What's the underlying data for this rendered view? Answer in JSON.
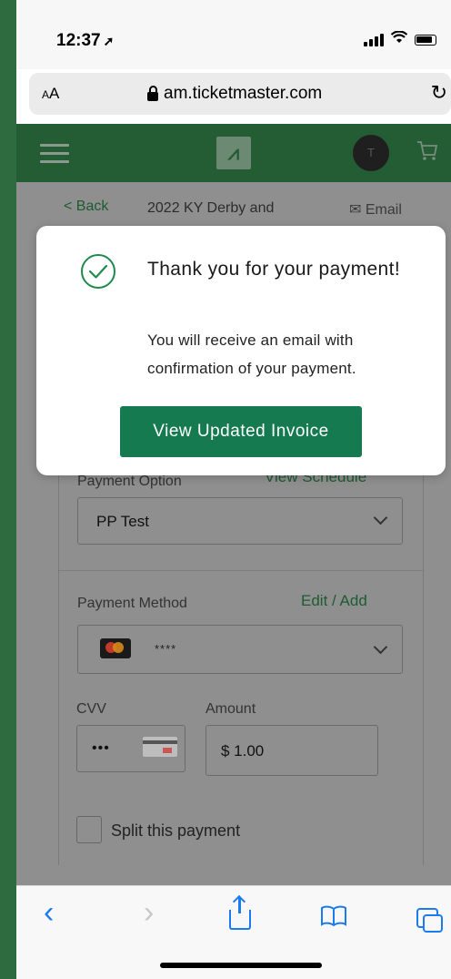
{
  "status": {
    "time": "12:37",
    "location_glyph": "➚"
  },
  "browser": {
    "text_size": "AA",
    "url": "am.ticketmaster.com",
    "reload_glyph": "↻"
  },
  "header": {
    "logo_glyph": "⩘",
    "avatar_initial": "T",
    "cart_glyph": "🛒"
  },
  "subnav": {
    "back": "< Back",
    "event": "2022 KY Derby and",
    "email": "Email"
  },
  "form": {
    "payment_option_label": "Payment Option",
    "view_schedule": "View Schedule",
    "payment_option_value": "PP Test",
    "payment_method_label": "Payment Method",
    "edit_add": "Edit / Add",
    "masked_card": "****",
    "cvv_label": "CVV",
    "cvv_value": "•••",
    "amount_label": "Amount",
    "amount_value": "$ 1.00",
    "split_label": "Split this payment"
  },
  "modal": {
    "title": "Thank you for your payment!",
    "message": "You will receive an email with confirmation of your payment.",
    "button": "View Updated Invoice"
  },
  "toolbar": {
    "back": "‹",
    "forward": "›",
    "bookmarks": "⊞"
  },
  "colors": {
    "brand_green": "#245c34",
    "button_green": "#157a4f",
    "ios_blue": "#1a7cf0"
  }
}
